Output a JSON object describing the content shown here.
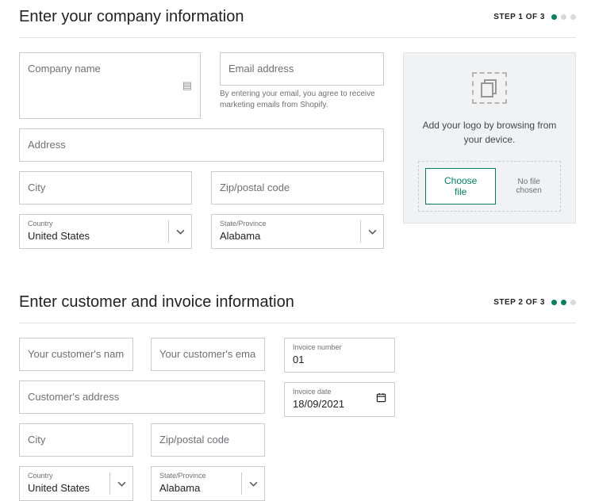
{
  "section1": {
    "title": "Enter your company information",
    "step_label": "STEP 1 OF 3",
    "company_name_ph": "Company name",
    "email_ph": "Email address",
    "email_help": "By entering your email, you agree to receive marketing emails from Shopify.",
    "address_ph": "Address",
    "city_ph": "City",
    "zip_ph": "Zip/postal code",
    "country_label": "Country",
    "country_value": "United States",
    "state_label": "State/Province",
    "state_value": "Alabama"
  },
  "logo": {
    "helper": "Add your logo by browsing from your device.",
    "choose": "Choose file",
    "status": "No file chosen"
  },
  "section2": {
    "title": "Enter customer and invoice information",
    "step_label": "STEP 2 OF 3",
    "cust_name_ph": "Your customer's name",
    "cust_email_ph": "Your customer's email",
    "cust_addr_ph": "Customer's address",
    "city_ph": "City",
    "zip_ph": "Zip/postal code",
    "country_label": "Country",
    "country_value": "United States",
    "state_label": "State/Province",
    "state_value": "Alabama",
    "inv_num_label": "Invoice number",
    "inv_num_value": "01",
    "inv_date_label": "Invoice date",
    "inv_date_value": "18/09/2021"
  }
}
